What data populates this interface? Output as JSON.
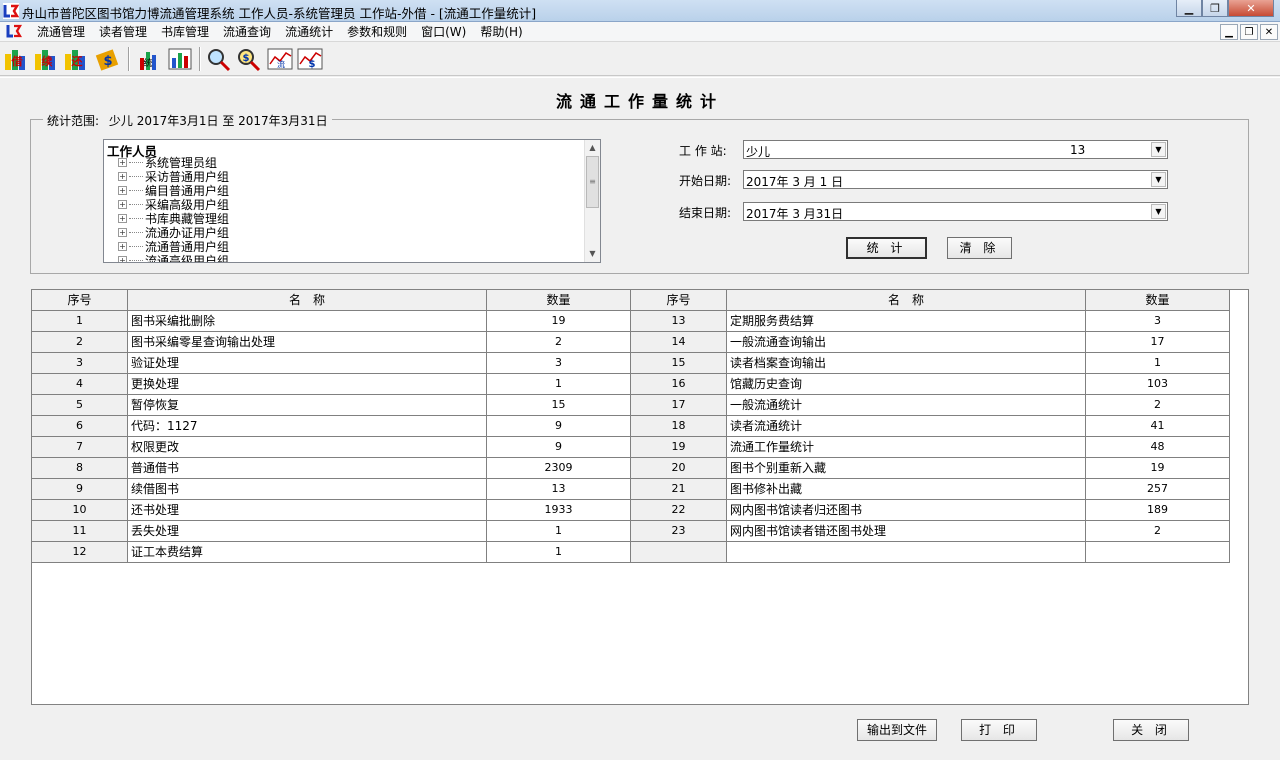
{
  "window": {
    "title": "舟山市普陀区图书馆力博流通管理系统 工作人员-系统管理员 工作站-外借 - [流通工作量统计]"
  },
  "menu": {
    "items": [
      "流通管理",
      "读者管理",
      "书库管理",
      "流通查询",
      "流通统计",
      "参数和规则",
      "窗口(W)",
      "帮助(H)"
    ]
  },
  "page": {
    "title": "流通工作量统计",
    "range_label": "统计范围:",
    "range_value": "少儿 2017年3月1日 至 2017年3月31日"
  },
  "tree": {
    "root": "工作人员",
    "nodes": [
      "系统管理员组",
      "采访普通用户组",
      "编目普通用户组",
      "采编高级用户组",
      "书库典藏管理组",
      "流通办证用户组",
      "流通普通用户组",
      "流通高级用户组"
    ]
  },
  "form": {
    "station_label": "工 作 站:",
    "station_value": "少儿",
    "station_code": "13",
    "start_label": "开始日期:",
    "start_value": "2017年 3 月 1 日",
    "end_label": "结束日期:",
    "end_value": "2017年 3 月31日",
    "stat_button": "统 计",
    "clear_button": "清 除"
  },
  "grid": {
    "headers": [
      "序号",
      "名　称",
      "数量",
      "序号",
      "名　称",
      "数量"
    ],
    "rows": [
      [
        "1",
        "图书采编批删除",
        "19",
        "13",
        "定期服务费结算",
        "3"
      ],
      [
        "2",
        "图书采编零星查询输出处理",
        "2",
        "14",
        "一般流通查询输出",
        "17"
      ],
      [
        "3",
        "验证处理",
        "3",
        "15",
        "读者档案查询输出",
        "1"
      ],
      [
        "4",
        "更换处理",
        "1",
        "16",
        "馆藏历史查询",
        "103"
      ],
      [
        "5",
        "暂停恢复",
        "15",
        "17",
        "一般流通统计",
        "2"
      ],
      [
        "6",
        "代码：1127",
        "9",
        "18",
        "读者流通统计",
        "41"
      ],
      [
        "7",
        "权限更改",
        "9",
        "19",
        "流通工作量统计",
        "48"
      ],
      [
        "8",
        "普通借书",
        "2309",
        "20",
        "图书个别重新入藏",
        "19"
      ],
      [
        "9",
        "续借图书",
        "13",
        "21",
        "图书修补出藏",
        "257"
      ],
      [
        "10",
        "还书处理",
        "1933",
        "22",
        "网内图书馆读者归还图书",
        "189"
      ],
      [
        "11",
        "丢失处理",
        "1",
        "23",
        "网内图书馆读者错还图书处理",
        "2"
      ],
      [
        "12",
        "证工本费结算",
        "1",
        "",
        "",
        ""
      ]
    ]
  },
  "bottom": {
    "export_button": "输出到文件",
    "print_button": "打 印",
    "close_button": "关 闭"
  },
  "colors": {
    "titlebar": "#b9d1ea",
    "window_bg": "#f0f0f0",
    "close_red": "#c74a33"
  }
}
